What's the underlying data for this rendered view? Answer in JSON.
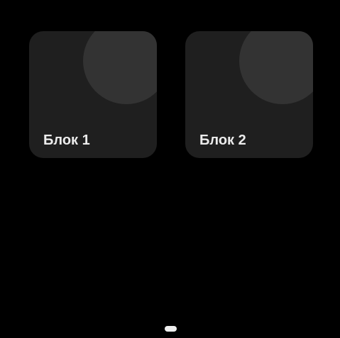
{
  "blocks": [
    {
      "label": "Блок 1"
    },
    {
      "label": "Блок 2"
    }
  ]
}
